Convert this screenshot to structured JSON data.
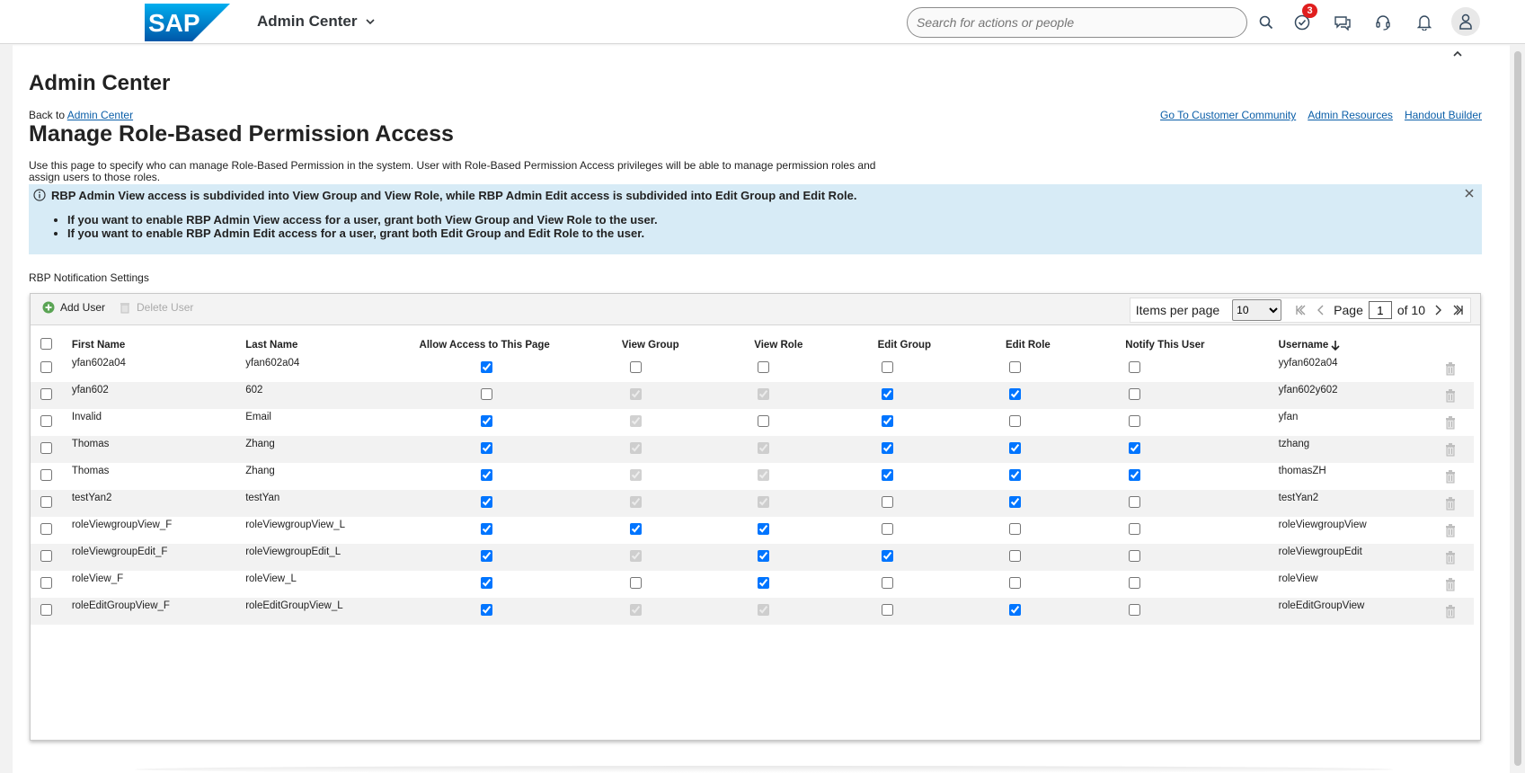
{
  "shell": {
    "app_title": "Admin Center",
    "search_placeholder": "Search for actions or people",
    "todo_badge": "3",
    "logo_text": "SAP"
  },
  "page": {
    "heading": "Admin Center",
    "back_prefix": "Back to",
    "back_link": "Admin Center",
    "title": "Manage Role-Based Permission Access",
    "links": [
      "Go To Customer Community",
      "Admin Resources",
      "Handout Builder"
    ],
    "description": "Use this page to specify who can manage Role-Based Permission in the system. User with Role-Based Permission Access privileges will be able to manage permission roles and assign users to those roles.",
    "info_main": "RBP Admin View access is subdivided into View Group and View Role, while RBP Admin Edit access is subdivided into Edit Group and Edit Role.",
    "info_items": [
      "If you want to enable RBP Admin View access for a user, grant both View Group and View Role to the user.",
      "If you want to enable RBP Admin Edit access for a user, grant both Edit Group and Edit Role to the user."
    ],
    "notification_settings": "RBP Notification Settings"
  },
  "toolbar": {
    "add_user": "Add User",
    "delete_user": "Delete User",
    "items_per_page_label": "Items per page",
    "items_per_page_value": "10",
    "page_label": "Page",
    "page_value": "1",
    "of_label": "of 10"
  },
  "table": {
    "columns": [
      "First Name",
      "Last Name",
      "Allow Access to This Page",
      "View Group",
      "View Role",
      "Edit Group",
      "Edit Role",
      "Notify This User",
      "Username"
    ],
    "rows": [
      {
        "first": "yfan602a04",
        "last": "yfan602a04",
        "allow": true,
        "view_group": false,
        "view_role": false,
        "edit_group": false,
        "edit_role": false,
        "notify": false,
        "username": "yyfan602a04",
        "vg_disabled": false,
        "vr_disabled": false
      },
      {
        "first": "yfan602",
        "last": "602",
        "allow": false,
        "view_group": true,
        "view_role": true,
        "edit_group": true,
        "edit_role": true,
        "notify": false,
        "username": "yfan602y602",
        "vg_disabled": true,
        "vr_disabled": true
      },
      {
        "first": "Invalid",
        "last": "Email",
        "allow": true,
        "view_group": true,
        "view_role": false,
        "edit_group": true,
        "edit_role": false,
        "notify": false,
        "username": "yfan",
        "vg_disabled": true,
        "vr_disabled": false
      },
      {
        "first": "Thomas",
        "last": "Zhang",
        "allow": true,
        "view_group": true,
        "view_role": true,
        "edit_group": true,
        "edit_role": true,
        "notify": true,
        "username": "tzhang",
        "vg_disabled": true,
        "vr_disabled": true
      },
      {
        "first": "Thomas",
        "last": "Zhang",
        "allow": true,
        "view_group": true,
        "view_role": true,
        "edit_group": true,
        "edit_role": true,
        "notify": true,
        "username": "thomasZH",
        "vg_disabled": true,
        "vr_disabled": true
      },
      {
        "first": "testYan2",
        "last": "testYan",
        "allow": true,
        "view_group": true,
        "view_role": true,
        "edit_group": false,
        "edit_role": true,
        "notify": false,
        "username": "testYan2",
        "vg_disabled": true,
        "vr_disabled": true
      },
      {
        "first": "roleViewgroupView_F",
        "last": "roleViewgroupView_L",
        "allow": true,
        "view_group": true,
        "view_role": true,
        "edit_group": false,
        "edit_role": false,
        "notify": false,
        "username": "roleViewgroupView",
        "vg_disabled": false,
        "vr_disabled": false
      },
      {
        "first": "roleViewgroupEdit_F",
        "last": "roleViewgroupEdit_L",
        "allow": true,
        "view_group": true,
        "view_role": true,
        "edit_group": true,
        "edit_role": false,
        "notify": false,
        "username": "roleViewgroupEdit",
        "vg_disabled": true,
        "vr_disabled": false
      },
      {
        "first": "roleView_F",
        "last": "roleView_L",
        "allow": true,
        "view_group": false,
        "view_role": true,
        "edit_group": false,
        "edit_role": false,
        "notify": false,
        "username": "roleView",
        "vg_disabled": false,
        "vr_disabled": false
      },
      {
        "first": "roleEditGroupView_F",
        "last": "roleEditGroupView_L",
        "allow": true,
        "view_group": true,
        "view_role": true,
        "edit_group": false,
        "edit_role": true,
        "notify": false,
        "username": "roleEditGroupView",
        "vg_disabled": true,
        "vr_disabled": true
      }
    ]
  },
  "colors": {
    "link": "#0a5ea8",
    "info_bg": "#d7ebf6",
    "badge": "#e01e1e",
    "logo_blue": "#1d6fc4"
  }
}
